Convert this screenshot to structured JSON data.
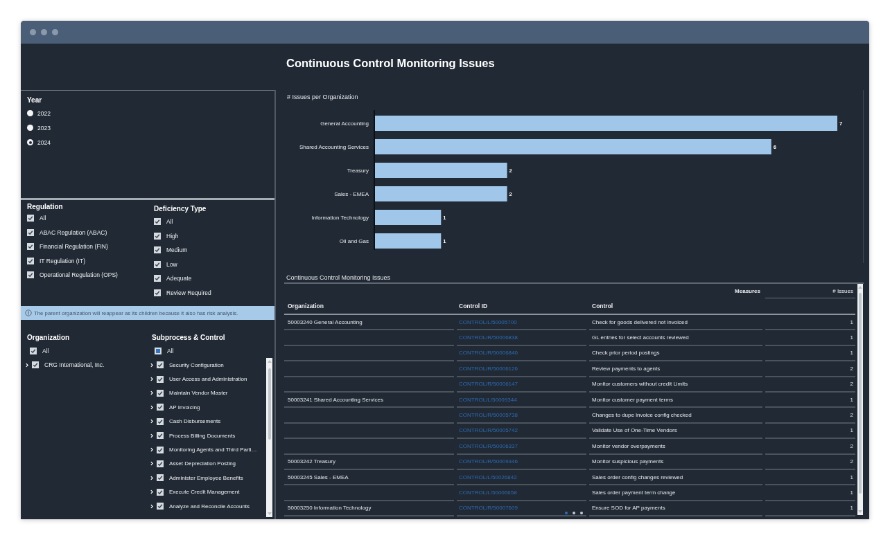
{
  "page_title": "Continuous Control Monitoring Issues",
  "filters": {
    "year": {
      "label": "Year",
      "options": [
        {
          "label": "2022",
          "selected": false
        },
        {
          "label": "2023",
          "selected": false
        },
        {
          "label": "2024",
          "selected": true
        }
      ]
    },
    "regulation": {
      "label": "Regulation",
      "items": [
        {
          "label": "All",
          "checked": true
        },
        {
          "label": "ABAC Regulation (ABAC)",
          "checked": true
        },
        {
          "label": "Financial Regulation (FIN)",
          "checked": true
        },
        {
          "label": "IT Regulation (IT)",
          "checked": true
        },
        {
          "label": "Operational Regulation (OPS)",
          "checked": true
        }
      ]
    },
    "deficiency_type": {
      "label": "Deficiency Type",
      "items": [
        {
          "label": "All",
          "checked": true
        },
        {
          "label": "High",
          "checked": true
        },
        {
          "label": "Medium",
          "checked": true
        },
        {
          "label": "Low",
          "checked": true
        },
        {
          "label": "Adequate",
          "checked": true
        },
        {
          "label": "Review Required",
          "checked": true
        }
      ]
    },
    "info_message": "The parent organization will reappear as its children because it also has risk analysis.",
    "organization": {
      "label": "Organization",
      "all": {
        "label": "All",
        "checked": true
      },
      "items": [
        {
          "label": "CRG International, Inc.",
          "checked": true,
          "expanded": false
        }
      ]
    },
    "subprocess_control": {
      "label": "Subprocess & Control",
      "all": {
        "label": "All",
        "checked": false,
        "indeterminate": true
      },
      "items": [
        {
          "label": "Security Configuration",
          "checked": true,
          "expanded": false
        },
        {
          "label": "User Access and Administration",
          "checked": true,
          "expanded": false
        },
        {
          "label": "Maintain Vendor Master",
          "checked": true,
          "expanded": false
        },
        {
          "label": "AP Invoicing",
          "checked": true,
          "expanded": false
        },
        {
          "label": "Cash Disbursements",
          "checked": true,
          "expanded": false
        },
        {
          "label": "Process Billing Documents",
          "checked": true,
          "expanded": false
        },
        {
          "label": "Monitoring Agents and Third Parti…",
          "checked": true,
          "expanded": false
        },
        {
          "label": "Asset Depreciation Posting",
          "checked": true,
          "expanded": false
        },
        {
          "label": "Administer Employee Benefits",
          "checked": true,
          "expanded": false
        },
        {
          "label": "Execute Credit Management",
          "checked": true,
          "expanded": false
        },
        {
          "label": "Analyze and Reconcile Accounts",
          "checked": true,
          "expanded": false
        }
      ]
    }
  },
  "chart": {
    "chart_data": {
      "type": "bar",
      "orientation": "horizontal",
      "title": "# Issues per Organization",
      "categories": [
        "General Accounting",
        "Shared Accounting Services",
        "Treasury",
        "Sales - EMEA",
        "Information Technology",
        "Oil and Gas"
      ],
      "values": [
        7,
        6,
        2,
        2,
        1,
        1
      ],
      "data_labels": true
    }
  },
  "table": {
    "title": "Continuous Control Monitoring Issues",
    "column_group_label": "Measures",
    "columns": [
      {
        "label": "Organization"
      },
      {
        "label": "Control ID"
      },
      {
        "label": "Control"
      },
      {
        "label": "# Issues"
      }
    ],
    "rows": [
      {
        "organization": "50003240 General Accounting",
        "control_id": "CONTROL/L/50005700",
        "control": "Check for goods delivered not invoiced",
        "issues": "1"
      },
      {
        "control_id": "CONTROL/R/50006838",
        "control": "GL entries for select accounts reviewed",
        "issues": "1"
      },
      {
        "control_id": "CONTROL/R/50006840",
        "control": "Check prior period postings",
        "issues": "1"
      },
      {
        "control_id": "CONTROL/R/50006126",
        "control": "Review payments to agents",
        "issues": "2"
      },
      {
        "control_id": "CONTROL/R/50006147",
        "control": "Monitor customers without credit Limits",
        "issues": "2"
      },
      {
        "organization": "50003241 Shared Accounting Services",
        "control_id": "CONTROL/L/50009344",
        "control": "Monitor customer payment terms",
        "issues": "1"
      },
      {
        "control_id": "CONTROL/R/50005738",
        "control": "Changes to dupe invoice config checked",
        "issues": "2"
      },
      {
        "control_id": "CONTROL/R/50005742",
        "control": "Validate Use of One-Time Vendors",
        "issues": "1"
      },
      {
        "control_id": "CONTROL/R/50006337",
        "control": "Monitor vendor overpayments",
        "issues": "2"
      },
      {
        "organization": "50003242 Treasury",
        "control_id": "CONTROL/R/50009346",
        "control": "Monitor suspicious payments",
        "issues": "2"
      },
      {
        "organization": "50003245 Sales - EMEA",
        "control_id": "CONTROL/L/50026842",
        "control": "Sales order config changes reviewed",
        "issues": "1"
      },
      {
        "control_id": "CONTROL/L/50006658",
        "control": "Sales order payment term change",
        "issues": "1"
      },
      {
        "organization": "50003250 Information Technology",
        "control_id": "CONTROL/R/50007609",
        "control": "Ensure SOD for AP payments",
        "issues": "1"
      }
    ]
  },
  "pagination": [
    {
      "selected": true
    },
    {
      "selected": false
    },
    {
      "selected": false
    }
  ]
}
